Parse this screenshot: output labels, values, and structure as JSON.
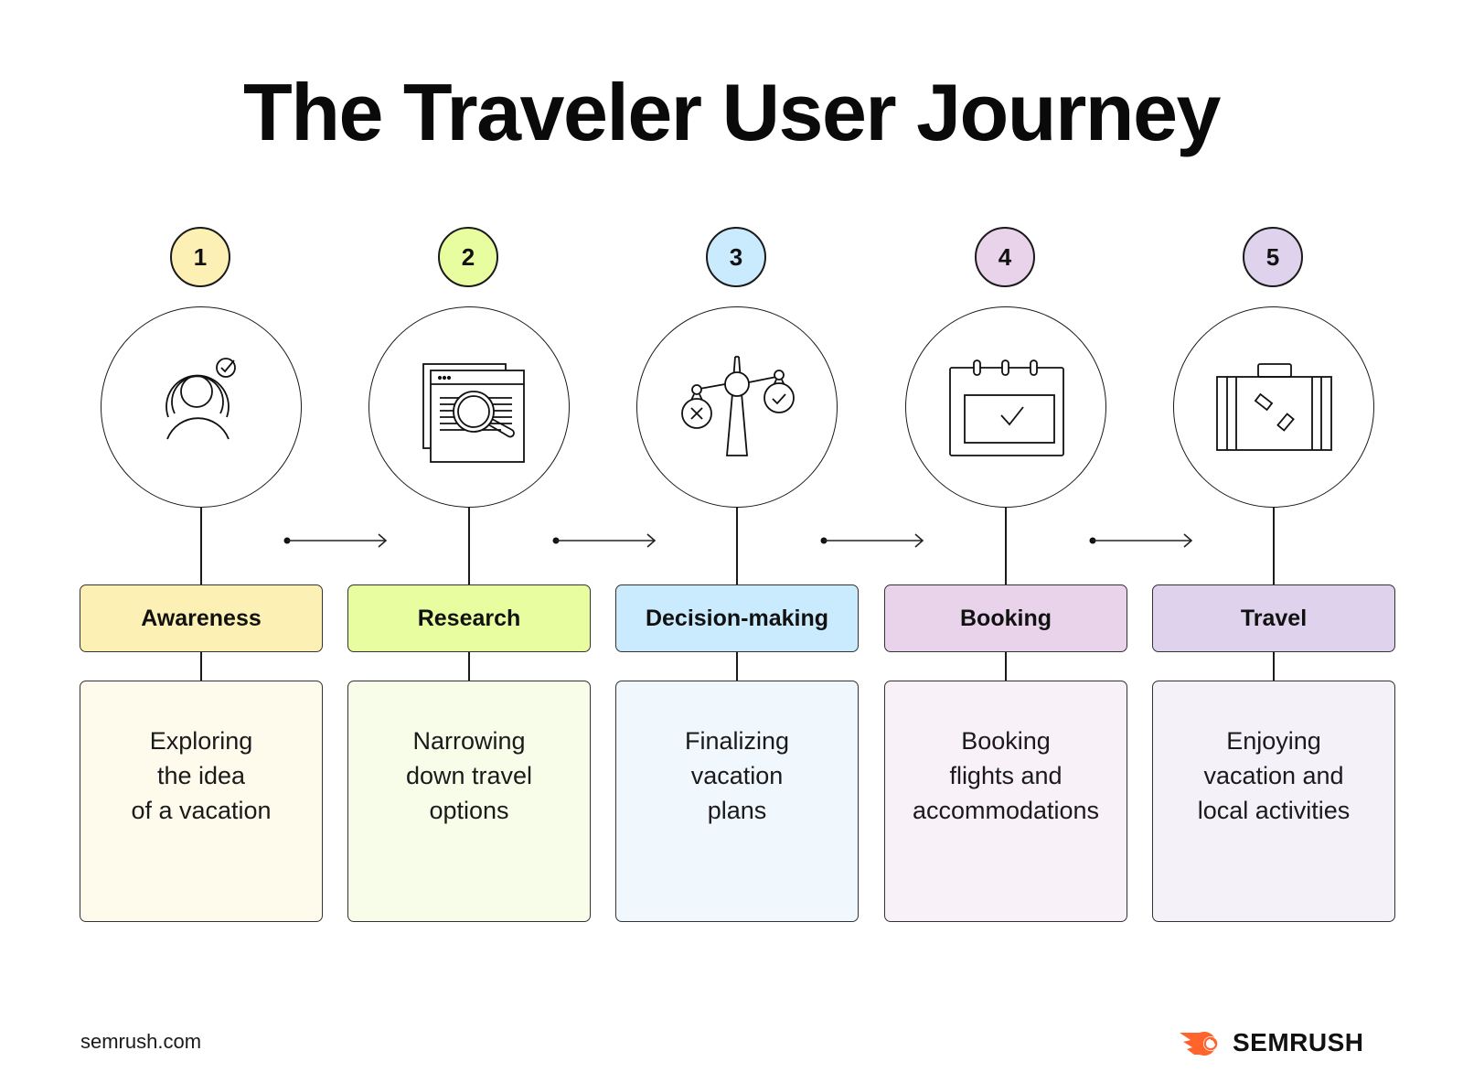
{
  "title": "The Traveler User Journey",
  "steps": [
    {
      "number": "1",
      "stage": "Awareness",
      "icon": "person-radar-check-icon",
      "description": [
        "Exploring",
        "the idea",
        "of a vacation"
      ],
      "colors": {
        "badge": "#fdf0b4",
        "stage": "#fdf0b4",
        "desc": "#fefbed"
      }
    },
    {
      "number": "2",
      "stage": "Research",
      "icon": "browser-magnifier-icon",
      "description": [
        "Narrowing",
        "down travel",
        "options"
      ],
      "colors": {
        "badge": "#e8fca0",
        "stage": "#e8fca0",
        "desc": "#f8fde9"
      }
    },
    {
      "number": "3",
      "stage": "Decision-making",
      "icon": "balance-scale-icon",
      "description": [
        "Finalizing",
        "vacation",
        "plans"
      ],
      "colors": {
        "badge": "#c9ebfd",
        "stage": "#c9ebfd",
        "desc": "#f0f8fe"
      }
    },
    {
      "number": "4",
      "stage": "Booking",
      "icon": "calendar-check-icon",
      "description": [
        "Booking",
        "flights and",
        "accommodations"
      ],
      "colors": {
        "badge": "#e8d3ea",
        "stage": "#e8d3ea",
        "desc": "#f8f1f8"
      }
    },
    {
      "number": "5",
      "stage": "Travel",
      "icon": "suitcase-icon",
      "description": [
        "Enjoying",
        "vacation and",
        "local activities"
      ],
      "colors": {
        "badge": "#ded2ec",
        "stage": "#ded2ec",
        "desc": "#f4f1f9"
      }
    }
  ],
  "footer": {
    "url": "semrush.com",
    "brand": "SEMRUSH",
    "brand_color": "#ff642d"
  }
}
